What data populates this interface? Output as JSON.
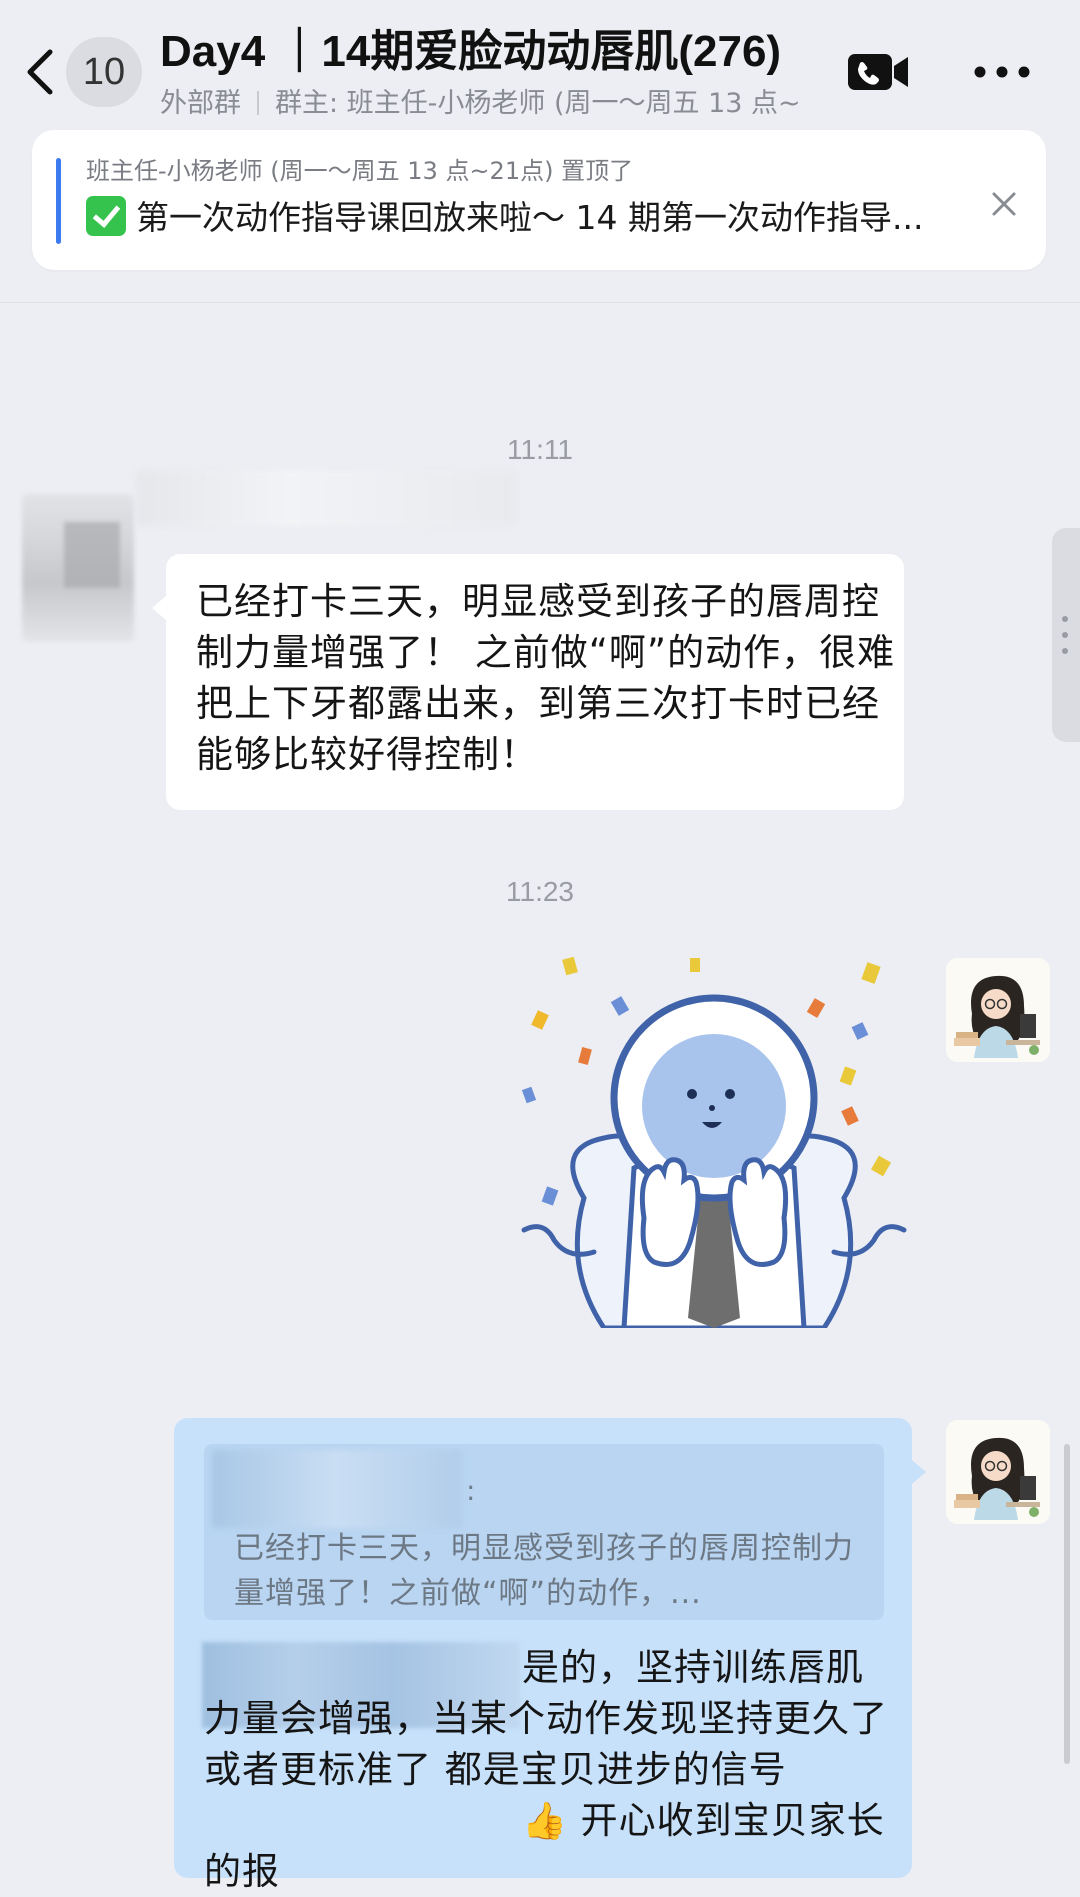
{
  "header": {
    "back_icon": "chevron-left-icon",
    "unread_count": "10",
    "title": "Day4 ｜14期爱脸动动唇肌(276)",
    "subtitle_tag": "外部群",
    "subtitle_owner": "群主: 班主任-小杨老师 (周一～周五 13 点~21点)",
    "video_call_icon": "video-call-icon",
    "more_icon": "more-icon"
  },
  "pinned": {
    "meta": "班主任-小杨老师 (周一～周五 13 点~21点) 置顶了",
    "content": "第一次动作指导课回放来啦～ 14 期第一次动作指导...",
    "check_icon": "check-mark-icon",
    "close_icon": "close-icon"
  },
  "messages": {
    "time_1": "11:11",
    "msg_1": "已经打卡三天，明显感受到孩子的唇周控制力量增强了！ 之前做“啊”的动作，很难把上下牙都露出来，到第三次打卡时已经能够比较好得控制！",
    "time_2": "11:23",
    "sticker_icon": "celebration-sticker-icon",
    "avatar_icon": "teacher-avatar-icon",
    "reply": {
      "quote_colon": ":",
      "quote_text": "已经打卡三天，明显感受到孩子的唇周控制力量增强了！之前做“啊”的动作，...",
      "text_part1": "是的，坚持训练唇肌力量会增强，当某个动作发现坚持更久了 或者更标准了 都是宝贝进步的信号",
      "thumb": "👍",
      "text_part2": " 开心收到宝贝家长的报"
    }
  },
  "colors": {
    "background": "#eceef3",
    "reply_bubble": "#c7e1fa",
    "pin_accent": "#3d7cf0",
    "check_green": "#35c24d"
  }
}
